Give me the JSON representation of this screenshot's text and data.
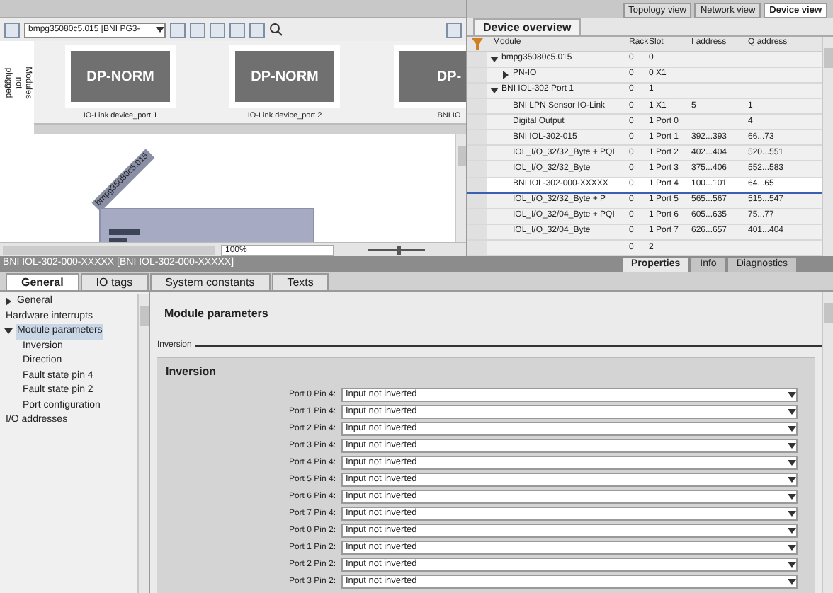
{
  "view_tabs": [
    {
      "label": "Topology view",
      "selected": false
    },
    {
      "label": "Network view",
      "selected": false
    },
    {
      "label": "Device view",
      "selected": true
    }
  ],
  "device_toolbar": {
    "device_select": "bmpg35080c5.015 [BNI PG3-"
  },
  "module_strip": {
    "side_label": "Modules not plugged",
    "cards": [
      {
        "title": "DP-NORM",
        "caption": "IO-Link device_port 1"
      },
      {
        "title": "DP-NORM",
        "caption": "IO-Link device_port 2"
      },
      {
        "title": "DP-",
        "caption": "BNI IO"
      }
    ]
  },
  "canvas": {
    "device_label": "bmpg35080c5.015",
    "zoom": "100%",
    "zoom_slider": {
      "level": 0.55
    }
  },
  "device_overview": {
    "tab": "Device overview",
    "columns": [
      "Module",
      "Rack",
      "Slot",
      "I address",
      "Q address"
    ],
    "rows": [
      {
        "module": "bmpg35080c5.015",
        "rack": "0",
        "slot": "0",
        "expanded": true,
        "selected": false,
        "children": [
          {
            "module": "PN-IO",
            "rack": "0",
            "slot": "0 X1",
            "expanded": false,
            "selected": false
          }
        ]
      },
      {
        "module": "BNI IOL-302 Port 1",
        "rack": "0",
        "slot": "1",
        "expanded": true,
        "selected": false,
        "children": [
          {
            "module": "BNI LPN Sensor IO-Link",
            "rack": "0",
            "slot": "1 X1",
            "i_address": "5",
            "q_address": "1",
            "selected": false
          },
          {
            "module": "Digital Output",
            "rack": "0",
            "slot": "1 Port 0",
            "q_address": "4",
            "selected": false
          },
          {
            "module": "BNI IOL-302-015",
            "rack": "0",
            "slot": "1 Port 1",
            "i_address": "392...393",
            "q_address": "66...73",
            "selected": false
          },
          {
            "module": "IOL_I/O_32/32_Byte + PQI",
            "rack": "0",
            "slot": "1 Port 2",
            "i_address": "402...404",
            "q_address": "520...551",
            "selected": false
          },
          {
            "module": "IOL_I/O_32/32_Byte",
            "rack": "0",
            "slot": "1 Port 3",
            "i_address": "375...406",
            "q_address": "552...583",
            "selected": false
          },
          {
            "module": "BNI IOL-302-000-XXXXX",
            "rack": "0",
            "slot": "1 Port 4",
            "i_address": "100...101",
            "q_address": "64...65",
            "selected": true
          },
          {
            "module": "IOL_I/O_32/32_Byte + P",
            "rack": "0",
            "slot": "1 Port 5",
            "i_address": "565...567",
            "q_address": "515...547",
            "selected": false
          },
          {
            "module": "IOL_I/O_32/04_Byte + PQI",
            "rack": "0",
            "slot": "1 Port 6",
            "i_address": "605...635",
            "q_address": "75...77",
            "selected": false
          },
          {
            "module": "IOL_I/O_32/04_Byte",
            "rack": "0",
            "slot": "1 Port 7",
            "i_address": "626...657",
            "q_address": "401...404",
            "selected": false
          }
        ]
      },
      {
        "rack": "0",
        "slot": "2",
        "selected": false
      }
    ]
  },
  "properties": {
    "title": "BNI IOL-302-000-XXXXX [BNI IOL-302-000-XXXXX]",
    "inspector_tabs": [
      {
        "label": "Properties",
        "selected": true
      },
      {
        "label": "Info",
        "selected": false
      },
      {
        "label": "Diagnostics",
        "selected": false
      }
    ],
    "tabs": [
      {
        "label": "General",
        "selected": true
      },
      {
        "label": "IO tags",
        "selected": false
      },
      {
        "label": "System constants",
        "selected": false
      },
      {
        "label": "Texts",
        "selected": false
      }
    ],
    "nav": [
      {
        "label": "General",
        "expanded": false,
        "selected": false
      },
      {
        "label": "Hardware interrupts",
        "selected": false
      },
      {
        "label": "Module parameters",
        "expanded": true,
        "selected": true,
        "children": [
          {
            "label": "Inversion",
            "selected": false
          },
          {
            "label": "Direction",
            "selected": false
          },
          {
            "label": "Fault state pin 4",
            "selected": false
          },
          {
            "label": "Fault state pin 2",
            "selected": false
          },
          {
            "label": "Port configuration",
            "selected": false
          }
        ]
      },
      {
        "label": "I/O addresses",
        "selected": false
      }
    ],
    "heading": "Module parameters",
    "section": "Inversion",
    "group": "Inversion",
    "params": [
      {
        "label": "Port 0 Pin 4:",
        "value": "Input not inverted"
      },
      {
        "label": "Port 1 Pin 4:",
        "value": "Input not inverted"
      },
      {
        "label": "Port 2 Pin 4:",
        "value": "Input not inverted"
      },
      {
        "label": "Port 3 Pin 4:",
        "value": "Input not inverted"
      },
      {
        "label": "Port 4 Pin 4:",
        "value": "Input not inverted"
      },
      {
        "label": "Port 5 Pin 4:",
        "value": "Input not inverted"
      },
      {
        "label": "Port 6 Pin 4:",
        "value": "Input not inverted"
      },
      {
        "label": "Port 7 Pin 4:",
        "value": "Input not inverted"
      },
      {
        "label": "Port 0 Pin 2:",
        "value": "Input not inverted"
      },
      {
        "label": "Port 1 Pin 2:",
        "value": "Input not inverted"
      },
      {
        "label": "Port 2 Pin 2:",
        "value": "Input not inverted"
      },
      {
        "label": "Port 3 Pin 2:",
        "value": "Input not inverted"
      }
    ]
  }
}
